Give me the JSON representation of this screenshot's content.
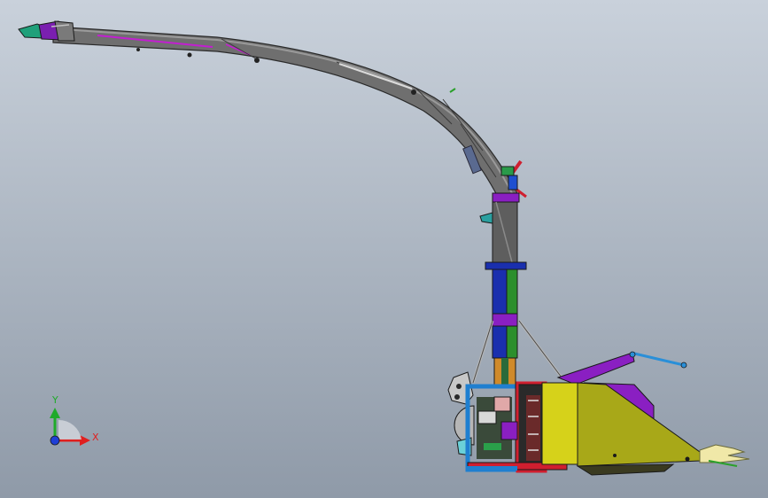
{
  "viewport": {
    "background_top": "#c9d1db",
    "background_bottom": "#8f9aa8"
  },
  "triad": {
    "x_label": "X",
    "y_label": "Y",
    "x_color": "#e01f1f",
    "y_color": "#1faa2a",
    "origin_color": "#1f3fd6"
  },
  "colors": {
    "chute_fill": "#6f6f6f",
    "chute_edge": "#2a2a2a",
    "spout_green": "#1fa07a",
    "spout_purple": "#7a1fb0",
    "magenta": "#c21fd0",
    "mast_grey": "#5e5e5e",
    "mast_blue": "#1a2fae",
    "mast_green": "#2c8f2c",
    "mast_orange": "#d08a2a",
    "frame_blue": "#1f7fd0",
    "frame_red": "#cf1f2f",
    "hopper_yellow": "#d6d21a",
    "hopper_olive": "#a8a818",
    "arm_purple": "#8a1fc2",
    "tube_blue": "#2a8fd8",
    "tip_cream": "#f0e8a8",
    "pale_grey": "#c8c8c8",
    "dark": "#1c1c1c"
  }
}
